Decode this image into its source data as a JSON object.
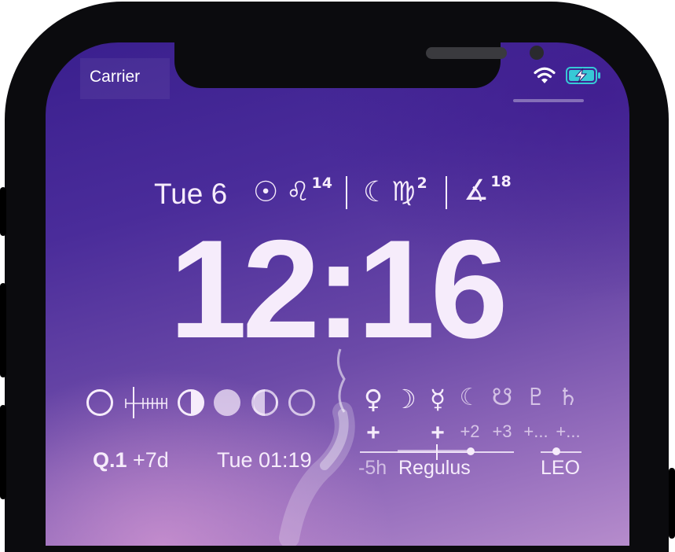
{
  "status_bar": {
    "carrier": "Carrier",
    "wifi_icon": "wifi-icon",
    "battery_icon": "battery-charging-icon"
  },
  "widget_header": {
    "date": "Tue 6",
    "sun_symbol": "☉",
    "sun_sign": "♌",
    "sun_degree": "14",
    "moon_symbol": "☾",
    "moon_sign": "♍",
    "moon_degree": "2",
    "angle_symbol": "∡",
    "angle_degree": "18"
  },
  "clock": {
    "time": "12:16"
  },
  "moon_phases": {
    "icons": [
      "new-moon-icon",
      "first-quarter-icon",
      "full-moon-icon",
      "last-quarter-icon",
      "new-moon-icon"
    ]
  },
  "phase_info": {
    "quarter": "Q.1",
    "offset": "+7d",
    "next_time": "Tue 01:19"
  },
  "planets": [
    {
      "symbol": "♀",
      "mark": "+"
    },
    {
      "symbol": "☽",
      "mark": ""
    },
    {
      "symbol": "☿",
      "mark": "+"
    },
    {
      "symbol": "☾",
      "mark": "+2"
    },
    {
      "symbol": "☋",
      "mark": "+3"
    },
    {
      "symbol": "♇",
      "mark": "+..."
    },
    {
      "symbol": "♄",
      "mark": "+..."
    }
  ],
  "star_info": {
    "offset": "-5h",
    "star": "Regulus",
    "sign": "LEO"
  },
  "colors": {
    "text": "#f6ecfb",
    "bg_top": "#3a1f8e",
    "bg_bottom": "#b68ccc",
    "battery_fill": "#37c9d6"
  }
}
